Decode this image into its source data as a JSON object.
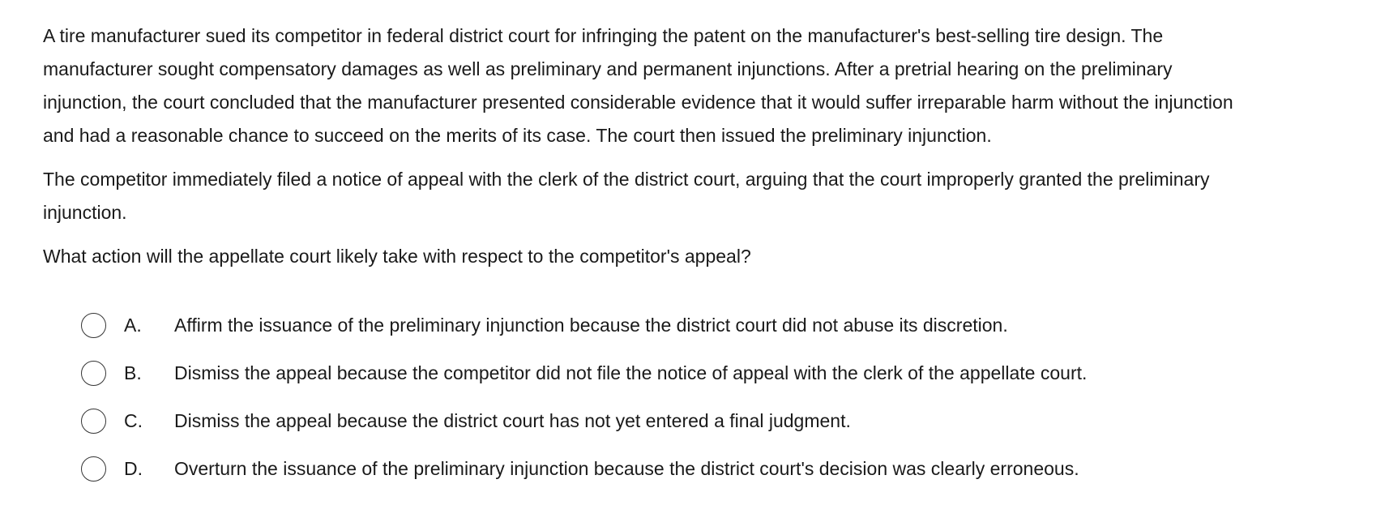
{
  "question": {
    "paragraphs": [
      {
        "lines": [
          "A tire manufacturer sued its competitor in federal district court for infringing the patent on the manufacturer's best-selling tire design.  The",
          "manufacturer sought compensatory damages as well as preliminary and permanent injunctions.  After a pretrial hearing on the preliminary",
          "injunction, the court concluded that the manufacturer presented considerable evidence that it would suffer irreparable harm without the injunction",
          "and had a reasonable chance to succeed on the merits of its case.  The court then issued the preliminary injunction."
        ]
      },
      {
        "lines": [
          "The competitor immediately filed a notice of appeal with the clerk of the district court, arguing that the court improperly granted the preliminary",
          "injunction."
        ]
      }
    ],
    "prompt": "What action will the appellate court likely take with respect to the competitor's appeal?"
  },
  "options": [
    {
      "letter": "A.",
      "text": "Affirm the issuance of the preliminary injunction because the district court did not abuse its discretion."
    },
    {
      "letter": "B.",
      "text": "Dismiss the appeal because the competitor did not file the notice of appeal with the clerk of the appellate court."
    },
    {
      "letter": "C.",
      "text": "Dismiss the appeal because the district court has not yet entered a final judgment."
    },
    {
      "letter": "D.",
      "text": "Overturn the issuance of the preliminary injunction because the district court's decision was clearly erroneous."
    }
  ]
}
